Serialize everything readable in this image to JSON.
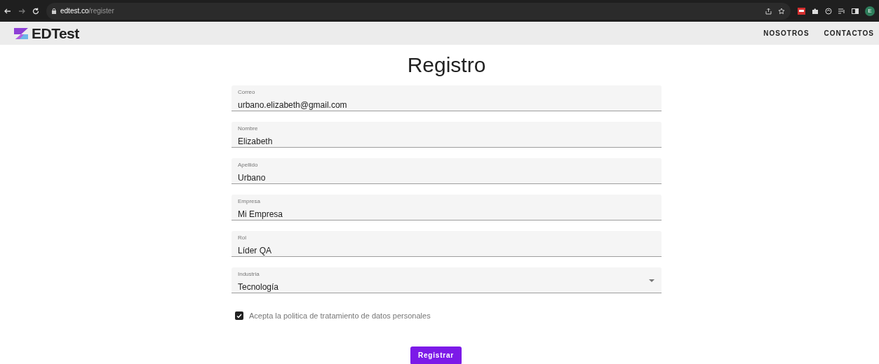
{
  "browser": {
    "url_host": "edtest.co",
    "url_path": "/register",
    "profile_initial": "E"
  },
  "header": {
    "logo_text": "EDTest",
    "nav": [
      "NOSOTROS",
      "CONTACTOS"
    ]
  },
  "form": {
    "title": "Registro",
    "fields": [
      {
        "kind": "text",
        "label": "Correo",
        "value": "urbano.elizabeth@gmail.com"
      },
      {
        "kind": "text",
        "label": "Nombre",
        "value": "Elizabeth"
      },
      {
        "kind": "text",
        "label": "Apellido",
        "value": "Urbano"
      },
      {
        "kind": "text",
        "label": "Empresa",
        "value": "Mi Empresa"
      },
      {
        "kind": "text",
        "label": "Rol",
        "value": "Líder QA"
      },
      {
        "kind": "select",
        "label": "Industria",
        "value": "Tecnología"
      }
    ],
    "consent": {
      "label": "Acepta la politica de tratamiento de datos personales",
      "checked": true
    },
    "submit": "Registrar"
  }
}
